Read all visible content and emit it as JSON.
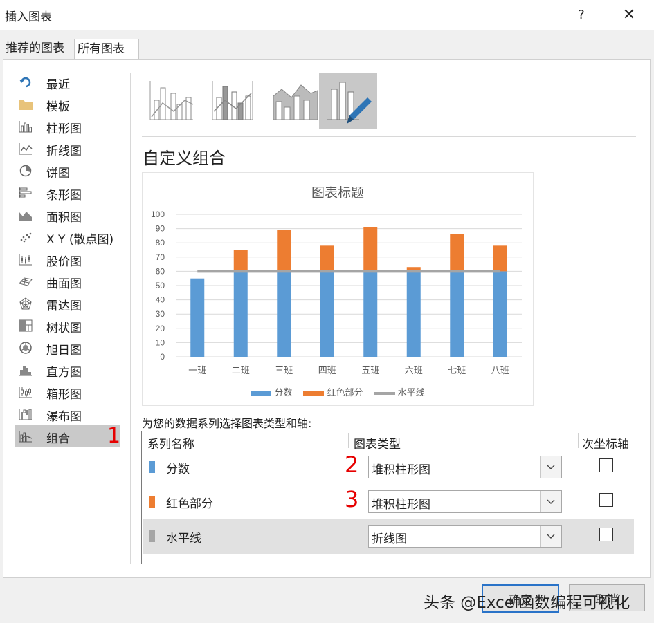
{
  "window": {
    "title": "插入图表",
    "help": "?",
    "close": "✕"
  },
  "tabs": [
    "推荐的图表",
    "所有图表"
  ],
  "sidebar": {
    "items": [
      {
        "label": "最近",
        "icon": "recent-icon"
      },
      {
        "label": "模板",
        "icon": "folder-icon"
      },
      {
        "label": "柱形图",
        "icon": "column-chart-icon"
      },
      {
        "label": "折线图",
        "icon": "line-chart-icon"
      },
      {
        "label": "饼图",
        "icon": "pie-chart-icon"
      },
      {
        "label": "条形图",
        "icon": "bar-chart-icon"
      },
      {
        "label": "面积图",
        "icon": "area-chart-icon"
      },
      {
        "label": "X Y (散点图)",
        "icon": "scatter-chart-icon"
      },
      {
        "label": "股价图",
        "icon": "stock-chart-icon"
      },
      {
        "label": "曲面图",
        "icon": "surface-chart-icon"
      },
      {
        "label": "雷达图",
        "icon": "radar-chart-icon"
      },
      {
        "label": "树状图",
        "icon": "treemap-icon"
      },
      {
        "label": "旭日图",
        "icon": "sunburst-icon"
      },
      {
        "label": "直方图",
        "icon": "histogram-icon"
      },
      {
        "label": "箱形图",
        "icon": "box-whisker-icon"
      },
      {
        "label": "瀑布图",
        "icon": "waterfall-icon"
      },
      {
        "label": "组合",
        "icon": "combo-chart-icon"
      }
    ],
    "selected_index": 16,
    "marker": "1"
  },
  "combo_types": {
    "icons": [
      "clustered-column-line-icon",
      "clustered-column-line-secondary-icon",
      "stacked-area-column-icon",
      "custom-combo-icon"
    ],
    "selected_index": 3
  },
  "subtype_title": "自定义组合",
  "chart_data": {
    "type": "bar",
    "title": "图表标题",
    "categories": [
      "一班",
      "二班",
      "三班",
      "四班",
      "五班",
      "六班",
      "七班",
      "八班"
    ],
    "series": [
      {
        "name": "分数",
        "kind": "stacked-bar",
        "color": "#5b9bd5",
        "values": [
          55,
          60,
          60,
          60,
          60,
          60,
          60,
          60
        ]
      },
      {
        "name": "红色部分",
        "kind": "stacked-bar",
        "color": "#ed7d31",
        "values": [
          0,
          15,
          29,
          18,
          31,
          3,
          26,
          18
        ]
      },
      {
        "name": "水平线",
        "kind": "line",
        "color": "#a5a5a5",
        "values": [
          60,
          60,
          60,
          60,
          60,
          60,
          60,
          60
        ]
      }
    ],
    "ylim": [
      0,
      100
    ],
    "yticks": [
      0,
      10,
      20,
      30,
      40,
      50,
      60,
      70,
      80,
      90,
      100
    ],
    "grid": true,
    "legend": "bottom"
  },
  "series_table": {
    "prompt": "为您的数据系列选择图表类型和轴:",
    "headers": {
      "name": "系列名称",
      "type": "图表类型",
      "secondary": "次坐标轴"
    },
    "rows": [
      {
        "name": "分数",
        "color": "#5b9bd5",
        "chart_type": "堆积柱形图",
        "secondary": false,
        "marker": "2"
      },
      {
        "name": "红色部分",
        "color": "#ed7d31",
        "chart_type": "堆积柱形图",
        "secondary": false,
        "marker": "3"
      },
      {
        "name": "水平线",
        "color": "#a5a5a5",
        "chart_type": "折线图",
        "secondary": false,
        "marker": ""
      }
    ]
  },
  "buttons": {
    "ok": "确定",
    "cancel": "取消"
  },
  "watermark": "头条 @Excel函数编程可视化"
}
